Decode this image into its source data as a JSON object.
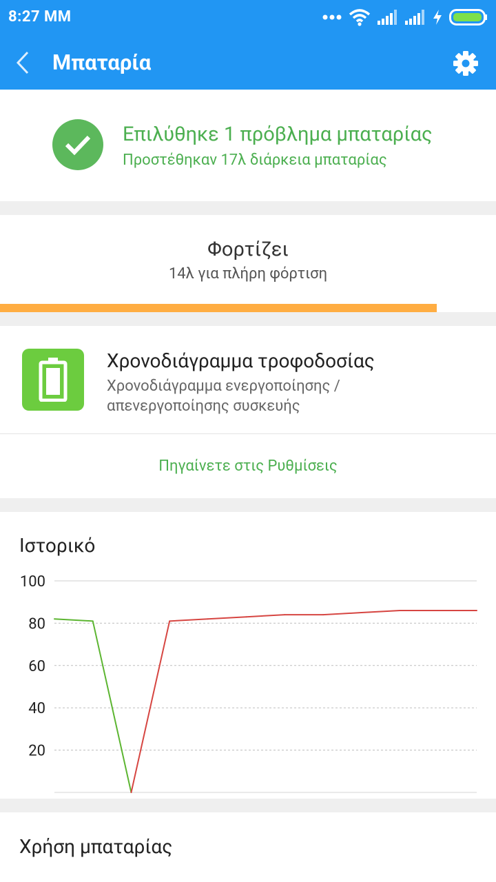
{
  "status_bar": {
    "time": "8:27 MM",
    "icons": [
      "more-dots-icon",
      "wifi-icon",
      "signal-icon",
      "signal-icon",
      "charging-bolt-icon",
      "battery-icon"
    ]
  },
  "app_bar": {
    "title": "Μπαταρία",
    "back_icon": "chevron-left-icon",
    "settings_icon": "gear-icon"
  },
  "resolved": {
    "title": "Επιλύθηκε 1 πρόβλημα μπαταρίας",
    "subtitle": "Προστέθηκαν 17λ  διάρκεια μπαταρίας"
  },
  "charging": {
    "title": "Φορτίζει",
    "subtitle": "14λ  για πλήρη φόρτιση",
    "progress_fraction": 0.88
  },
  "schedule": {
    "title": "Χρονοδιάγραμμα τροφοδοσίας",
    "subtitle": "Χρονοδιάγραμμα ενεργοποίησης / απενεργοποίησης συσκευής",
    "action_label": "Πηγαίνετε στις Ρυθμίσεις"
  },
  "history": {
    "title": "Ιστορικό"
  },
  "chart_data": {
    "type": "line",
    "title": "",
    "ylim": [
      0,
      100
    ],
    "y_ticks": [
      "100",
      "80",
      "60",
      "40",
      "20"
    ],
    "grid": true,
    "x": [
      0,
      1,
      2,
      3,
      4,
      5,
      6,
      7,
      8,
      9,
      10,
      11
    ],
    "values": [
      82,
      81,
      0,
      81,
      82,
      83,
      84,
      84,
      85,
      86,
      86,
      86
    ],
    "segment_states": [
      "discharging",
      "discharging",
      "charging",
      "charging",
      "charging",
      "charging",
      "charging",
      "charging",
      "charging",
      "charging",
      "charging"
    ],
    "colors": {
      "discharging": "#5cb531",
      "charging": "#d64541"
    }
  },
  "usage": {
    "title": "Χρήση μπαταρίας"
  },
  "colors": {
    "primary": "#2196f3",
    "success": "#4caf50",
    "progress": "#ffad42",
    "tile": "#6ccc3f"
  }
}
